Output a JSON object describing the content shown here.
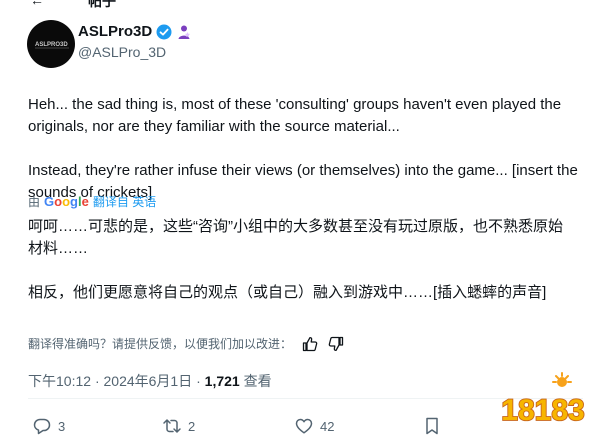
{
  "header": {
    "back_icon": "back-arrow-icon",
    "title": "帖子"
  },
  "author": {
    "name": "ASLPro3D",
    "handle": "@ASLPro_3D",
    "logo_text": "ASLPRO3D",
    "verified_icon": "verified-badge-icon",
    "affiliate_icon": "affiliate-badge-icon",
    "badge_color": "#1d9bf0",
    "affiliate_color": "#7b3fbf"
  },
  "tweet": {
    "text_en_1": "Heh... the sad thing is, most of these 'consulting' groups haven't even played the originals, nor are they familiar with the source material...",
    "text_en_2": "Instead, they're rather infuse their views (or themselves) into the game... [insert the sounds of crickets]"
  },
  "translation": {
    "by": "由",
    "provider": "Google",
    "translated_from": "翻译自 英语",
    "text_zh_1": "呵呵……可悲的是，这些“咨询”小组中的大多数甚至没有玩过原版，也不熟悉原始材料……",
    "text_zh_2": "相反，他们更愿意将自己的观点（或自己）融入到游戏中……[插入蟋蟀的声音]",
    "feedback_prompt": "翻译得准确吗？请提供反馈，以便我们加以改进：",
    "thumbs_up_icon": "thumbs-up-icon",
    "thumbs_down_icon": "thumbs-down-icon"
  },
  "meta": {
    "time": "下午10:12",
    "sep1": "·",
    "date": "2024年6月1日",
    "sep2": "·",
    "views_count": "1,721",
    "views_label": "查看"
  },
  "actions": {
    "reply_icon": "reply-icon",
    "reply_count": "3",
    "retweet_icon": "retweet-icon",
    "retweet_count": "2",
    "like_icon": "like-heart-icon",
    "like_count": "42",
    "bookmark_icon": "bookmark-icon"
  },
  "watermark": {
    "text": "18183"
  }
}
